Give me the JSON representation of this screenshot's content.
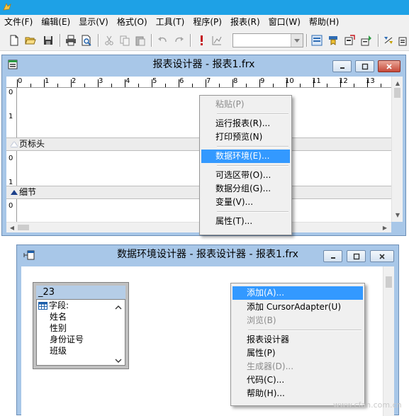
{
  "menubar": {
    "items": [
      "文件(F)",
      "编辑(E)",
      "显示(V)",
      "格式(O)",
      "工具(T)",
      "程序(P)",
      "报表(R)",
      "窗口(W)",
      "帮助(H)"
    ]
  },
  "toolbar": {
    "icons": [
      "new-file-icon",
      "open-folder-icon",
      "save-icon",
      "print-icon",
      "print-preview-icon",
      "cut-icon",
      "copy-icon",
      "paste-icon",
      "undo-icon",
      "redo-icon",
      "run-icon",
      "chart-icon",
      "report-controls-icon",
      "color-palette-icon",
      "layout-icon",
      "data-environment-icon",
      "align-icon"
    ],
    "combo_value": ""
  },
  "report_window": {
    "title": "报表设计器 - 报表1.frx",
    "ruler_numbers": [
      "0",
      "1",
      "2",
      "3",
      "4",
      "5",
      "6",
      "7",
      "8",
      "9",
      "10",
      "11",
      "12",
      "13"
    ],
    "left_ruler_numbers": [
      "0",
      "1",
      "0",
      "1",
      "0"
    ],
    "bands": [
      {
        "label": "页标头"
      },
      {
        "label": "细节"
      }
    ]
  },
  "report_context_menu": {
    "items": [
      {
        "label": "粘贴(P)",
        "disabled": true
      },
      {
        "label": "运行报表(R)...",
        "disabled": false
      },
      {
        "label": "打印预览(N)",
        "disabled": false
      },
      {
        "label": "数据环境(E)...",
        "highlighted": true
      },
      {
        "label": "可选区带(O)...",
        "disabled": false
      },
      {
        "label": "数据分组(G)...",
        "disabled": false
      },
      {
        "label": "变量(V)...",
        "disabled": false
      },
      {
        "label": "属性(T)...",
        "disabled": false
      }
    ]
  },
  "dataenv_window": {
    "title": "数据环境设计器 - 报表设计器 - 报表1.frx",
    "table": {
      "name": "_23",
      "fields_header": "字段:",
      "fields": [
        "姓名",
        "性别",
        "身份证号",
        "班级"
      ]
    }
  },
  "dataenv_context_menu": {
    "items": [
      {
        "label": "添加(A)...",
        "highlighted": true
      },
      {
        "label": "添加 CursorAdapter(U)",
        "disabled": false
      },
      {
        "label": "浏览(B)",
        "disabled": true
      },
      {
        "label": "报表设计器",
        "disabled": false
      },
      {
        "label": "属性(P)",
        "disabled": false
      },
      {
        "label": "生成器(D)...",
        "disabled": true
      },
      {
        "label": "代码(C)...",
        "disabled": false
      },
      {
        "label": "帮助(H)...",
        "disabled": false
      }
    ]
  },
  "watermark": "www.cfan.com.cn",
  "colors": {
    "title_blue": "#1ea1e6",
    "window_frame": "#a8c7e8",
    "highlight": "#3399ff",
    "close_red": "#c74a3a"
  }
}
